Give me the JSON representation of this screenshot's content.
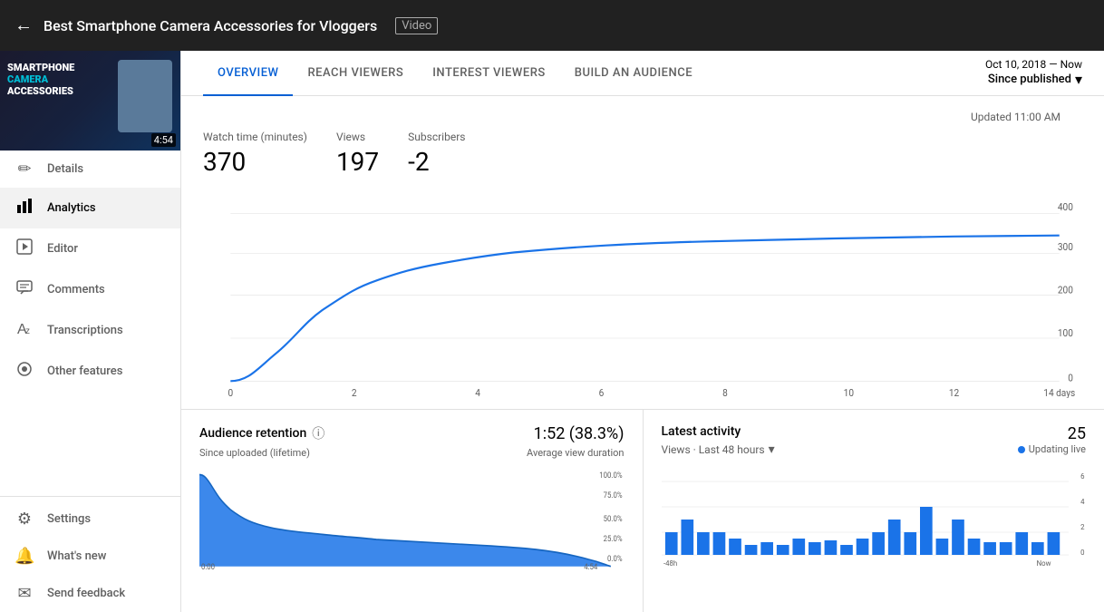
{
  "topbar": {
    "back_icon": "←",
    "title": "Best Smartphone Camera Accessories for Vloggers",
    "badge": "Video"
  },
  "sidebar": {
    "thumbnail": {
      "line1": "SMARTPHONE",
      "line2": "CAMERA",
      "line3": "ACCESSORIES",
      "duration": "4:54"
    },
    "nav_items": [
      {
        "id": "details",
        "icon": "✏️",
        "label": "Details",
        "active": false
      },
      {
        "id": "analytics",
        "icon": "📊",
        "label": "Analytics",
        "active": true
      },
      {
        "id": "editor",
        "icon": "🎬",
        "label": "Editor",
        "active": false
      },
      {
        "id": "comments",
        "icon": "💬",
        "label": "Comments",
        "active": false
      },
      {
        "id": "transcriptions",
        "icon": "🔤",
        "label": "Transcriptions",
        "active": false
      },
      {
        "id": "other",
        "icon": "⭐",
        "label": "Other features",
        "active": false
      }
    ],
    "bottom_items": [
      {
        "id": "settings",
        "icon": "⚙️",
        "label": "Settings"
      },
      {
        "id": "whats-new",
        "icon": "🔔",
        "label": "What's new"
      },
      {
        "id": "send-feedback",
        "icon": "💬",
        "label": "Send feedback"
      }
    ]
  },
  "tabs": [
    {
      "id": "overview",
      "label": "OVERVIEW",
      "active": true
    },
    {
      "id": "reach",
      "label": "REACH VIEWERS",
      "active": false
    },
    {
      "id": "interest",
      "label": "INTEREST VIEWERS",
      "active": false
    },
    {
      "id": "audience",
      "label": "BUILD AN AUDIENCE",
      "active": false
    }
  ],
  "date_selector": {
    "date_range": "Oct 10, 2018 — Now",
    "period": "Since published",
    "chevron": "▾"
  },
  "stats": {
    "updated_label": "Updated 11:00 AM",
    "items": [
      {
        "id": "watch-time",
        "label": "Watch time (minutes)",
        "value": "370"
      },
      {
        "id": "views",
        "label": "Views",
        "value": "197"
      },
      {
        "id": "subscribers",
        "label": "Subscribers",
        "value": "-2"
      }
    ]
  },
  "chart": {
    "y_labels": [
      "400",
      "300",
      "200",
      "100",
      "0"
    ],
    "x_labels": [
      "0",
      "2",
      "4",
      "6",
      "8",
      "10",
      "12",
      "14 days"
    ]
  },
  "audience_retention": {
    "title": "Audience retention",
    "metric": "1:52 (38.3%)",
    "subtitle_left": "Since uploaded (lifetime)",
    "subtitle_right": "Average view duration",
    "x_start": "0:00",
    "x_end": "4:54",
    "y_labels": [
      "100.0%",
      "75.0%",
      "50.0%",
      "25.0%",
      "0.0%"
    ]
  },
  "latest_activity": {
    "title": "Latest activity",
    "count": "25",
    "filter_label": "Views · Last 48 hours",
    "live_label": "Updating live",
    "x_start": "-48h",
    "x_end": "Now",
    "y_labels": [
      "6",
      "4",
      "2",
      "0"
    ]
  },
  "icons": {
    "back": "←",
    "info": "ⓘ",
    "chevron_down": "▾",
    "pencil": "✏",
    "bar_chart": "▦",
    "editor": "✂",
    "comments": "☰",
    "transcriptions": "Ã",
    "other": "★",
    "settings": "⚙",
    "whats_new": "🔔",
    "feedback": "✉"
  }
}
